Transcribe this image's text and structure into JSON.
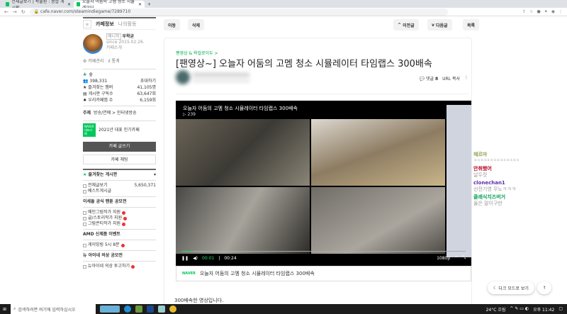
{
  "browser": {
    "tabs": [
      {
        "label": "전체글보기 | 왁물원 : 종합 게시판"
      },
      {
        "label": "오늘자 어둠의 고멤 청소 시뮬레이터"
      }
    ],
    "new_tab": "+",
    "url": "cafe.naver.com/steamindiegame/7289710"
  },
  "sidebar": {
    "tab_info": "카페정보",
    "tab_activity": "나의활동",
    "manager_badge": "매니저",
    "manager": "우왁굳",
    "since": "since 2015.02.26.",
    "cafe_intro": "카페소개",
    "admin": "카페관리",
    "stats": "통계",
    "level": "숲",
    "members": "398,331",
    "invite": "초대하기",
    "stat_rows": [
      {
        "label": "즐겨찾는 멤버",
        "value": "41,105명"
      },
      {
        "label": "게시판 구독수",
        "value": "63,647회"
      },
      {
        "label": "우리카페앱 수",
        "value": "6,159회"
      }
    ],
    "topic_label": "주제",
    "topic": "방송/연예 > 인터넷방송",
    "naver_badge": "NAVER 대표카페",
    "award": "2021년 대표 인기카페",
    "write": "카페 글쓰기",
    "chat": "카페 채팅",
    "fav_boards": "즐겨찾는 게시판",
    "boards": [
      {
        "label": "전체글보기",
        "count": "5,650,371"
      },
      {
        "label": "베스트게시글"
      }
    ],
    "sections": [
      {
        "title": "이세돌 공식 팬툰 공모전",
        "items": [
          "메인그림작가 지원",
          "글/스토리작가 지원",
          "그림콘티작가 지원"
        ]
      },
      {
        "title": "AMD 신제품 이벤트",
        "items": [
          "게이밍링 5시 8분"
        ]
      },
      {
        "title": "뉴 아이네 의상 공모전",
        "items": [
          "뉴아이네 의상 투고하기"
        ]
      }
    ]
  },
  "toolbar": {
    "move": "이동",
    "delete": "삭제",
    "prev": "이전글",
    "next": "다음글",
    "list": "목록"
  },
  "article": {
    "breadcrumb": "팬영상 & 왁컬로이두 >",
    "title": "[팬영상~] 오늘자 어둠의 고멤 청소 시뮬레이터 타임랩스 300배속",
    "comments_label": "댓글",
    "comments": "8",
    "url_copy": "URL 복사",
    "body": "300배속한 영상입니다."
  },
  "video": {
    "title": "오늘자 어둠의 고멤 청소 시뮬레이터 타임랩스 300배속",
    "views": "▷ 239",
    "current": "00:01",
    "duration": "00:24",
    "quality": "1080p",
    "progress_percent": 4,
    "caption_brand": "NAVER",
    "caption": "오늘자 어둠의 고멤 청소 시뮬레이터 타임랩스 300배속"
  },
  "chat": [
    {
      "name": "헤르마",
      "msg": "ㅋㅋㅋㅋㅋㅋㅋㅋㅋㅋㅋㅋㅋㅋ",
      "color": "#8ea34b"
    },
    {
      "name": "안취했어",
      "msg": "날두컷",
      "color": "#b5001c"
    },
    {
      "name": "clonechan1",
      "msg": "선전기영 무노ㅋㅋㅋ",
      "color": "#5b2ca8"
    },
    {
      "name": "클레식치즈버거",
      "msg": "옳은 말이구만",
      "color": "#08a055"
    }
  ],
  "floating": {
    "dark_mode": "다크 모드로 보기",
    "top": "↑"
  },
  "taskbar": {
    "search": "검색하려면 여기에 입력하십시오",
    "weather": "24°C 흐림",
    "time": "오후 11:42"
  }
}
